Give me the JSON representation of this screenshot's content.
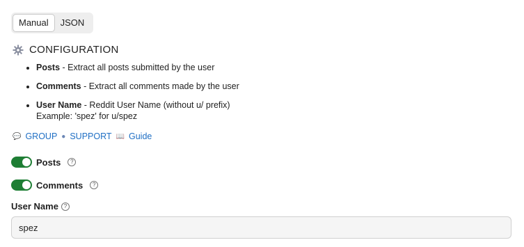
{
  "tabs": [
    {
      "label": "Manual",
      "active": true
    },
    {
      "label": "JSON",
      "active": false
    }
  ],
  "section": {
    "title": "CONFIGURATION",
    "icon": "gear-icon"
  },
  "description": [
    {
      "term": "Posts",
      "text": " - Extract all posts submitted by the user"
    },
    {
      "term": "Comments",
      "text": " - Extract all comments made by the user"
    },
    {
      "term": "User Name",
      "text": " - Reddit User Name (without u/ prefix)",
      "example": "Example: 'spez' for u/spez"
    }
  ],
  "links": [
    {
      "label": "GROUP",
      "icon": "chat-bubble-icon"
    },
    {
      "label": "SUPPORT",
      "icon": "support-icon"
    },
    {
      "label": "Guide",
      "icon": "book-icon"
    }
  ],
  "toggles": [
    {
      "label": "Posts",
      "on": true
    },
    {
      "label": "Comments",
      "on": true
    }
  ],
  "user_name": {
    "label": "User Name",
    "value": "spez"
  },
  "colors": {
    "toggle_on": "#1e7e34",
    "link": "#1f6fc4"
  }
}
